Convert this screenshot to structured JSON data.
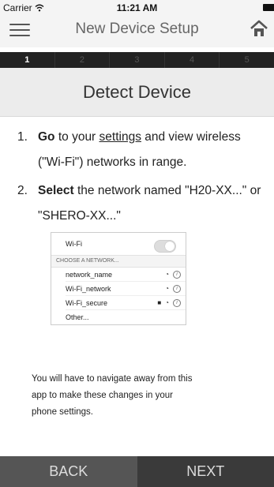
{
  "status": {
    "carrier": "Carrier",
    "time": "11:21 AM"
  },
  "nav": {
    "title": "New Device Setup"
  },
  "steps": [
    "1",
    "2",
    "3",
    "4",
    "5"
  ],
  "header": "Detect Device",
  "instructions": {
    "step1": {
      "num": "1.",
      "bold": "Go",
      "pre": " to your ",
      "link": "settings",
      "post": " and view wireless (\"Wi-Fi\") networks in range."
    },
    "step2": {
      "num": "2.",
      "bold": "Select",
      "post": " the network named \"H20-XX...\" or \"SHERO-XX...\""
    }
  },
  "wifi_panel": {
    "wifi_label": "Wi-Fi",
    "section": "CHOOSE A NETWORK...",
    "networks": [
      "network_name",
      "Wi-Fi_network",
      "Wi-Fi_secure",
      "Other..."
    ]
  },
  "note": "You will have to navigate away from this app to make these changes in your phone settings.",
  "footer": {
    "back": "BACK",
    "next": "NEXT"
  }
}
